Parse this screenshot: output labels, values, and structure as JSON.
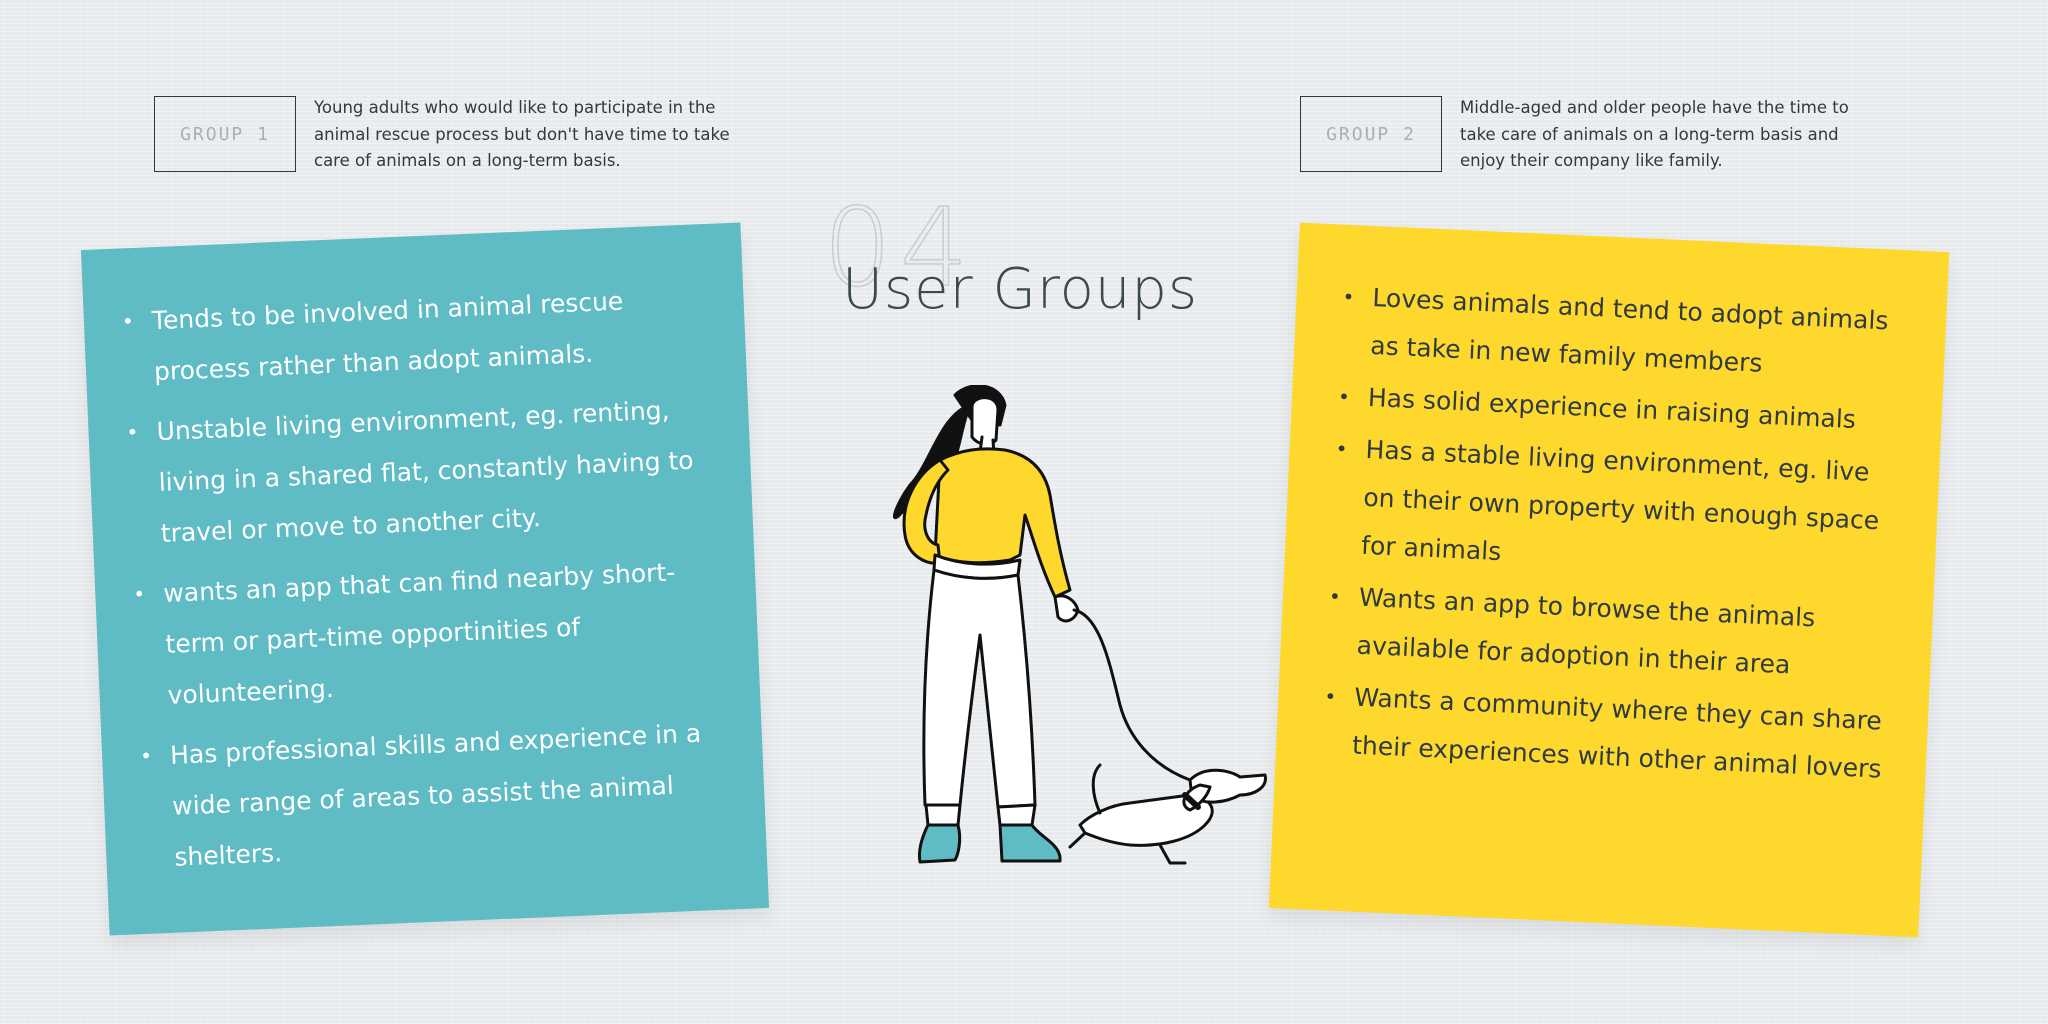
{
  "heading": {
    "number": "04",
    "title": "User Groups"
  },
  "group1": {
    "label": "GROUP 1",
    "description": "Young adults who would like to participate in the animal rescue process but don't have time to take care of animals on a long-term basis.",
    "points": [
      "Tends to be involved in animal rescue process rather than adopt animals.",
      "Unstable living environment, eg. renting, living in a shared flat, constantly having to travel or move to another city.",
      "wants an app that can find nearby short-term or part-time opportinities of volunteering.",
      "Has professional skills and experience in a wide range of areas to assist the animal shelters."
    ]
  },
  "group2": {
    "label": "GROUP 2",
    "description": "Middle-aged and older people have the time to take care of animals on a long-term basis and enjoy their company like family.",
    "points": [
      "Loves animals and tend to adopt animals as take in new family members",
      "Has solid experience in raising animals",
      "Has a stable living environment, eg. live on their own property with enough space for animals",
      "Wants an app to browse the animals available for adoption in their area",
      "Wants a community where they can share their experiences with other animal lovers"
    ]
  },
  "colors": {
    "teal": "#5fbbc4",
    "yellow": "#fed82c",
    "ink": "#2f3a40"
  },
  "illustration": {
    "icon": "woman-walking-dog-icon"
  }
}
